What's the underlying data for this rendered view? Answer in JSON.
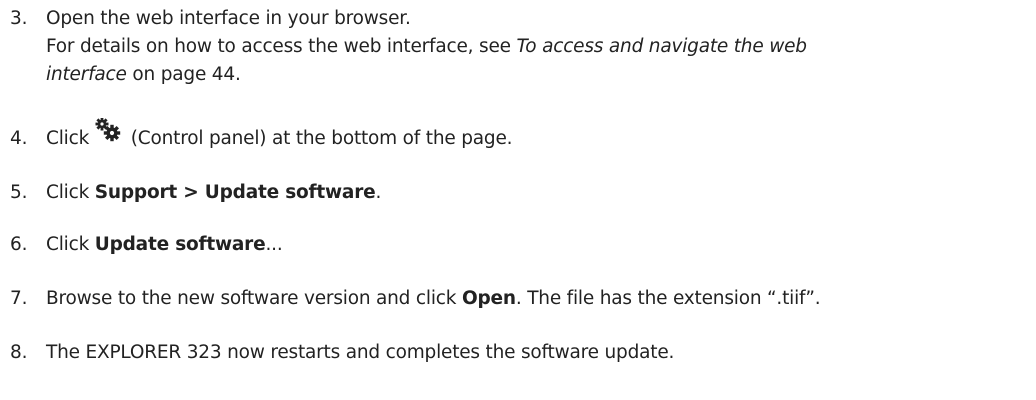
{
  "steps": [
    {
      "number": "3.",
      "lines": [
        "Open the web interface in your browser."
      ],
      "detail_prefix": "For details on how to access the web interface, see ",
      "detail_link": "To access and navigate the web interface",
      "detail_link_line1": "To access and navigate the web",
      "detail_link_line2": "interface",
      "detail_suffix": " on page 44."
    },
    {
      "number": "4.",
      "before_icon": "Click",
      "icon": "gears-icon",
      "after_icon": " (Control panel) at the bottom of the page."
    },
    {
      "number": "5.",
      "prefix": "Click ",
      "bold": "Support > Update software",
      "suffix": "."
    },
    {
      "number": "6.",
      "prefix": "Click ",
      "bold": "Update software",
      "suffix": "..."
    },
    {
      "number": "7.",
      "prefix": "Browse to the new software version and click ",
      "bold": "Open",
      "suffix": ". The file has the extension “.tiif”."
    },
    {
      "number": "8.",
      "text": "The EXPLORER 323 now restarts and completes the software update."
    }
  ]
}
